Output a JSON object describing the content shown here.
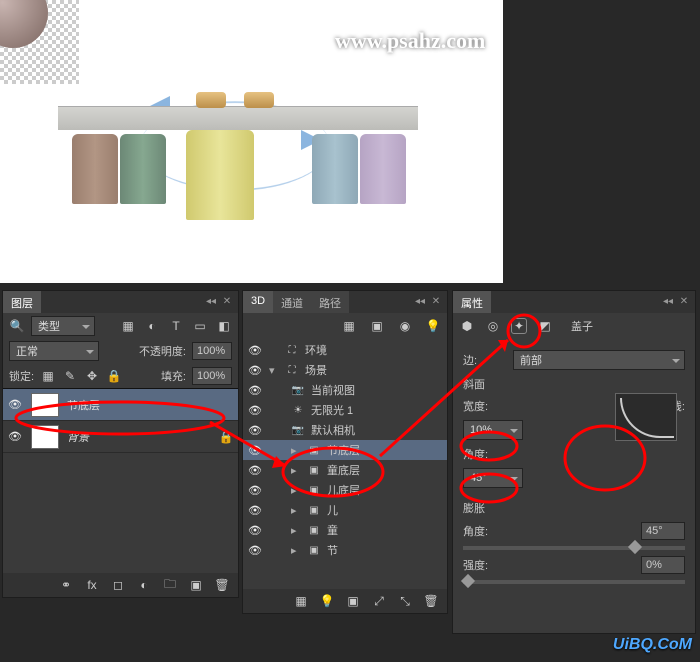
{
  "watermark_top": "www.psahz.com",
  "watermark_bottom": "UiBQ.CoM",
  "layers_panel": {
    "tab": "图层",
    "filter_label": "类型",
    "blend_mode": "正常",
    "opacity_label": "不透明度:",
    "opacity_value": "100%",
    "lock_label": "锁定:",
    "fill_label": "填充:",
    "fill_value": "100%",
    "layers": [
      {
        "name": "节底层",
        "visible": true,
        "selected": true
      },
      {
        "name": "背景",
        "visible": true,
        "selected": false
      }
    ],
    "footer_icons": [
      "link-icon",
      "fx-icon",
      "mask-icon",
      "adjust-icon",
      "group-icon",
      "new-icon",
      "trash-icon"
    ]
  },
  "three_d_panel": {
    "tabs": [
      "3D",
      "通道",
      "路径"
    ],
    "toolbar_icons": [
      "filter-scene",
      "filter-mesh",
      "filter-material",
      "filter-light"
    ],
    "items": [
      {
        "indent": 0,
        "icon": "scene-icon",
        "label": "环境"
      },
      {
        "indent": 0,
        "icon": "scene-icon",
        "label": "场景"
      },
      {
        "indent": 1,
        "icon": "camera-icon",
        "label": "当前视图"
      },
      {
        "indent": 1,
        "icon": "light-icon",
        "label": "无限光 1"
      },
      {
        "indent": 1,
        "icon": "camera-icon",
        "label": "默认相机"
      },
      {
        "indent": 1,
        "icon": "mesh-icon",
        "label": "节底层",
        "selected": true
      },
      {
        "indent": 1,
        "icon": "mesh-icon",
        "label": "童底层"
      },
      {
        "indent": 1,
        "icon": "mesh-icon",
        "label": "儿底层"
      },
      {
        "indent": 1,
        "icon": "mesh-icon",
        "label": "儿"
      },
      {
        "indent": 1,
        "icon": "mesh-icon",
        "label": "童"
      },
      {
        "indent": 1,
        "icon": "mesh-icon",
        "label": "节"
      }
    ],
    "footer_icons": [
      "render-icon",
      "light-toggle",
      "ground-icon",
      "axis1",
      "axis2",
      "trash-icon"
    ]
  },
  "properties_panel": {
    "tab": "属性",
    "mode_icons": [
      "mesh",
      "deform",
      "cap",
      "coord"
    ],
    "caps_label": "盖子",
    "edge_label": "边:",
    "edge_value": "前部",
    "bevel_label": "斜面",
    "width_label": "宽度:",
    "width_value": "10%",
    "angle_label": "角度:",
    "angle_value": "45°",
    "contour_label": "等高线:",
    "inflate_label": "膨胀",
    "inflate_angle_label": "角度:",
    "inflate_angle_value": "45°",
    "strength_label": "强度:",
    "strength_value": "0%"
  }
}
